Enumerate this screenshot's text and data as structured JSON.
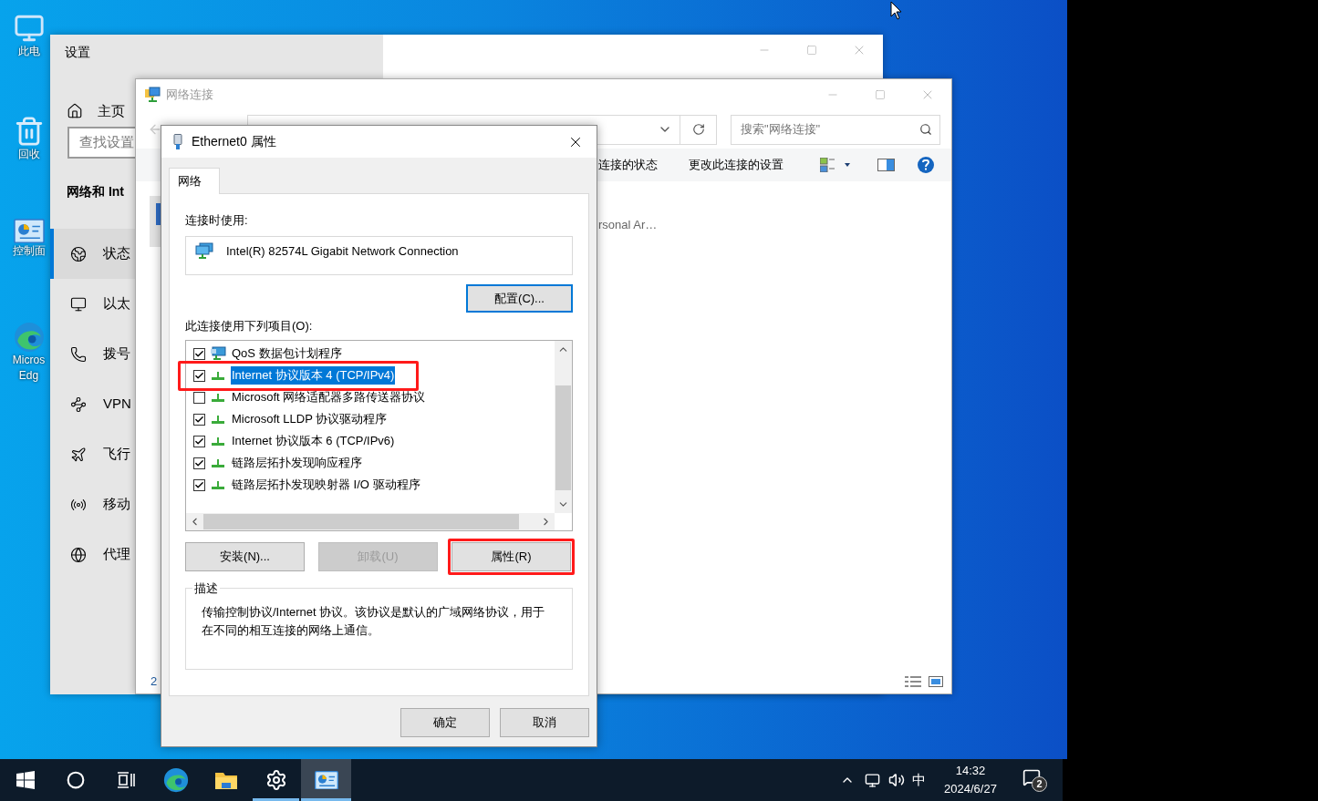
{
  "desktop": {
    "icons": [
      {
        "kind": "computer",
        "lines": [
          "此电"
        ]
      },
      {
        "kind": "recycle-bin",
        "lines": [
          "回收"
        ]
      },
      {
        "kind": "control-panel",
        "lines": [
          "控制面"
        ]
      },
      {
        "kind": "edge",
        "lines": [
          "Micros",
          "Edg"
        ]
      }
    ]
  },
  "settings_window": {
    "title": "设置",
    "home": "主页",
    "search": {
      "placeholder": "查找设置"
    },
    "heading": "网络和 Int",
    "nav": [
      {
        "kind": "status",
        "label": "状态",
        "selected": true
      },
      {
        "kind": "ethernet",
        "label": "以太",
        "selected": false
      },
      {
        "kind": "dialup",
        "label": "拨号",
        "selected": false
      },
      {
        "kind": "vpn",
        "label": "VPN",
        "selected": false
      },
      {
        "kind": "airplane",
        "label": "飞行",
        "selected": false
      },
      {
        "kind": "hotspot",
        "label": "移动",
        "selected": false
      },
      {
        "kind": "proxy",
        "label": "代理",
        "selected": false
      }
    ]
  },
  "network_window": {
    "title": "网络连接",
    "search": {
      "placeholder": "搜索\"网络连接\""
    },
    "toolbar": [
      "连接的状态",
      "更改此连接的设置"
    ],
    "item_text": "rsonal Ar…",
    "status_count": "2"
  },
  "dialog": {
    "title": "Ethernet0 属性",
    "tabs": [
      {
        "label": "网络",
        "selected": true
      }
    ],
    "connect_using_label": "连接时使用:",
    "adapter": "Intel(R) 82574L Gigabit Network Connection",
    "configure_button": "配置(C)...",
    "items_label": "此连接使用下列项目(O):",
    "items": [
      {
        "kind": "qos",
        "label": "QoS 数据包计划程序",
        "checked": true,
        "selected": false,
        "highlighted": false
      },
      {
        "kind": "protocol",
        "label": "Internet 协议版本 4 (TCP/IPv4)",
        "checked": true,
        "selected": true,
        "highlighted": true
      },
      {
        "kind": "protocol",
        "label": "Microsoft 网络适配器多路传送器协议",
        "checked": false,
        "selected": false,
        "highlighted": false
      },
      {
        "kind": "protocol",
        "label": "Microsoft LLDP 协议驱动程序",
        "checked": true,
        "selected": false,
        "highlighted": false
      },
      {
        "kind": "protocol",
        "label": "Internet 协议版本 6 (TCP/IPv6)",
        "checked": true,
        "selected": false,
        "highlighted": false
      },
      {
        "kind": "protocol",
        "label": "链路层拓扑发现响应程序",
        "checked": true,
        "selected": false,
        "highlighted": false
      },
      {
        "kind": "protocol",
        "label": "链路层拓扑发现映射器 I/O 驱动程序",
        "checked": true,
        "selected": false,
        "highlighted": false
      }
    ],
    "buttons": [
      {
        "label": "安装(N)...",
        "disabled": false,
        "highlighted": false
      },
      {
        "label": "卸载(U)",
        "disabled": true,
        "highlighted": false
      },
      {
        "label": "属性(R)",
        "disabled": false,
        "highlighted": true
      }
    ],
    "description": {
      "title": "描述",
      "text": "传输控制协议/Internet 协议。该协议是默认的广域网络协议，用于在不同的相互连接的网络上通信。"
    },
    "footer_buttons": [
      "确定",
      "取消"
    ]
  },
  "taskbar": {
    "apps": [
      {
        "kind": "start",
        "running": false,
        "selected": false
      },
      {
        "kind": "search",
        "running": false,
        "selected": false
      },
      {
        "kind": "task-view",
        "running": false,
        "selected": false
      },
      {
        "kind": "edge",
        "running": false,
        "selected": false
      },
      {
        "kind": "explorer",
        "running": false,
        "selected": false
      },
      {
        "kind": "settings",
        "running": true,
        "selected": false
      },
      {
        "kind": "control-panel",
        "running": true,
        "selected": true
      }
    ],
    "ime": "中",
    "time": "14:32",
    "date": "2024/6/27",
    "notifications": "2"
  }
}
